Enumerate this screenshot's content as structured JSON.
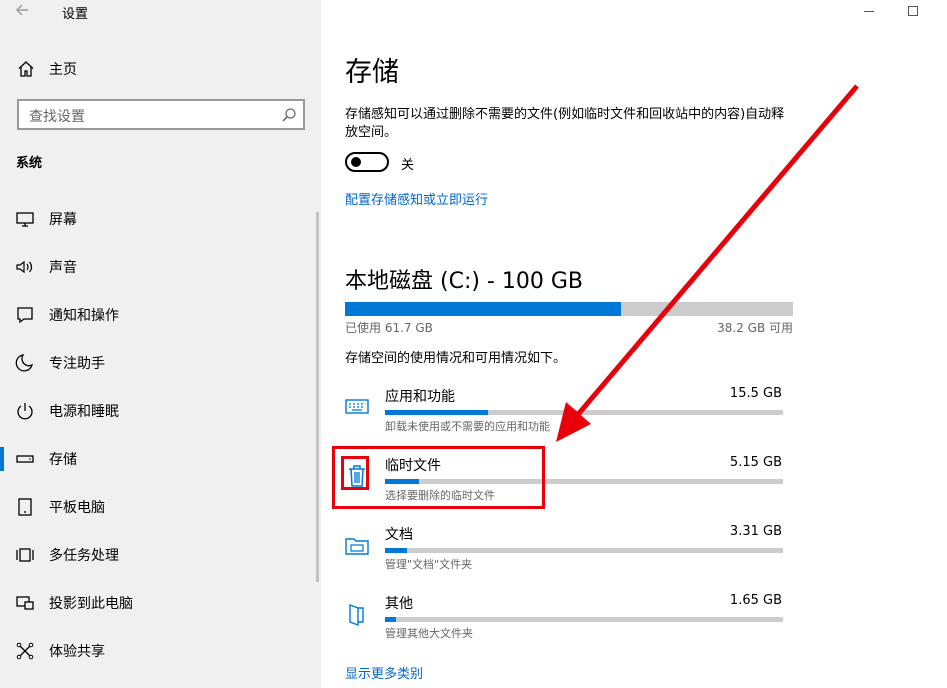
{
  "window": {
    "title": "设置"
  },
  "sidebar": {
    "home_label": "主页",
    "search_placeholder": "查找设置",
    "section_label": "系统",
    "items": [
      {
        "label": "屏幕",
        "icon": "display-icon"
      },
      {
        "label": "声音",
        "icon": "speaker-icon"
      },
      {
        "label": "通知和操作",
        "icon": "notification-icon"
      },
      {
        "label": "专注助手",
        "icon": "moon-icon"
      },
      {
        "label": "电源和睡眠",
        "icon": "power-icon"
      },
      {
        "label": "存储",
        "icon": "storage-icon",
        "selected": true
      },
      {
        "label": "平板电脑",
        "icon": "tablet-icon"
      },
      {
        "label": "多任务处理",
        "icon": "multitask-icon"
      },
      {
        "label": "投影到此电脑",
        "icon": "projection-icon"
      },
      {
        "label": "体验共享",
        "icon": "share-icon"
      }
    ]
  },
  "main": {
    "title": "存储",
    "description": "存储感知可以通过删除不需要的文件(例如临时文件和回收站中的内容)自动释放空间。",
    "toggle": {
      "state": "off",
      "label": "关"
    },
    "configure_link": "配置存储感知或立即运行",
    "disk": {
      "title": "本地磁盘 (C:) - 100 GB",
      "used_label": "已使用 61.7 GB",
      "free_label": "38.2 GB 可用",
      "used_fraction": 0.617
    },
    "usage_desc": "存储空间的使用情况和可用情况如下。",
    "categories": [
      {
        "name": "应用和功能",
        "size": "15.5 GB",
        "sub": "卸载未使用或不需要的应用和功能",
        "fraction": 0.26,
        "icon": "keyboard-icon"
      },
      {
        "name": "临时文件",
        "size": "5.15 GB",
        "sub": "选择要删除的临时文件",
        "fraction": 0.085,
        "icon": "trash-icon"
      },
      {
        "name": "文档",
        "size": "3.31 GB",
        "sub": "管理\"文档\"文件夹",
        "fraction": 0.055,
        "icon": "folder-icon"
      },
      {
        "name": "其他",
        "size": "1.65 GB",
        "sub": "管理其他大文件夹",
        "fraction": 0.028,
        "icon": "other-files-icon"
      }
    ],
    "more_link": "显示更多类别"
  },
  "colors": {
    "accent": "#0078d7",
    "link": "#0066cc",
    "annotation": "#e8000b",
    "sidebar_bg": "#f0f0f0"
  }
}
